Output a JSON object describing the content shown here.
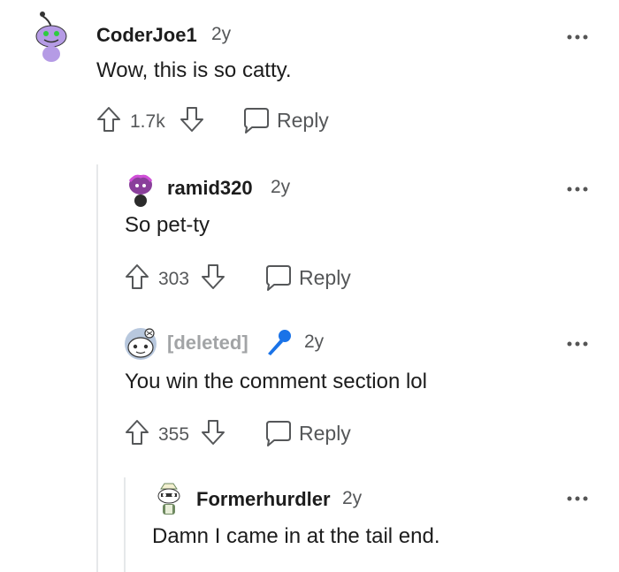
{
  "comments": [
    {
      "username": "CoderJoe1",
      "age": "2y",
      "body": "Wow, this is so catty.",
      "score": "1.7k",
      "reply_label": "Reply",
      "avatar_icon": "snoo-avatar-icon",
      "avatar_color": "#b59be5"
    },
    {
      "username": "ramid320",
      "age": "2y",
      "body": "So pet-ty",
      "score": "303",
      "reply_label": "Reply",
      "avatar_icon": "snoo-avatar-icon",
      "avatar_color": "#8a3f9b"
    },
    {
      "username": "[deleted]",
      "age": "2y",
      "body": "You win the comment section lol",
      "score": "355",
      "reply_label": "Reply",
      "avatar_icon": "snoo-avatar-icon",
      "badge_icon": "microphone-icon",
      "badge_color": "#1a73e8"
    },
    {
      "username": "Formerhurdler",
      "age": "2y",
      "body": "Damn I came in at the tail end.",
      "avatar_icon": "snoo-avatar-icon",
      "avatar_color": "#6f8a61"
    }
  ],
  "colors": {
    "text": "#1c1c1c",
    "muted": "#555759",
    "thread_line": "#e6e8ea",
    "deleted": "#a2a4a6"
  }
}
